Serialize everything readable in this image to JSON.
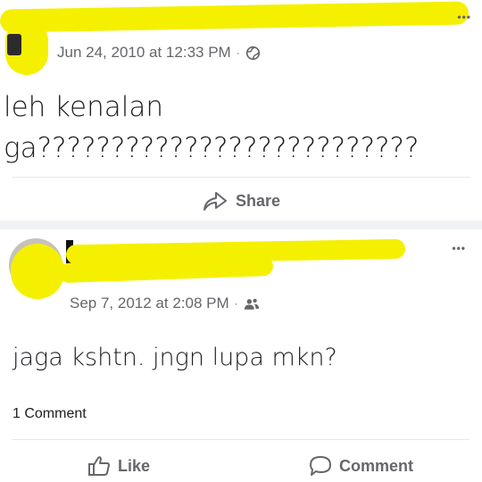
{
  "post1": {
    "timestamp": "Jun 24, 2010 at 12:33 PM",
    "separator": "·",
    "privacy_icon": "globe-icon",
    "text_line1": "leh kenalan",
    "text_line2": "ga??????????????????????????",
    "share_label": "Share",
    "more_label": "•••"
  },
  "post2": {
    "timestamp": "Sep 7, 2012 at 2:08 PM",
    "separator": "·",
    "privacy_icon": "friends-icon",
    "text": "jaga kshtn. jngn lupa mkn?",
    "comment_count": "1 Comment",
    "like_label": "Like",
    "comment_label": "Comment",
    "more_label": "•••"
  },
  "colors": {
    "redaction": "#f5f000",
    "meta_gray": "#65676b",
    "text": "#1c1e21",
    "divider": "#e4e6eb"
  }
}
